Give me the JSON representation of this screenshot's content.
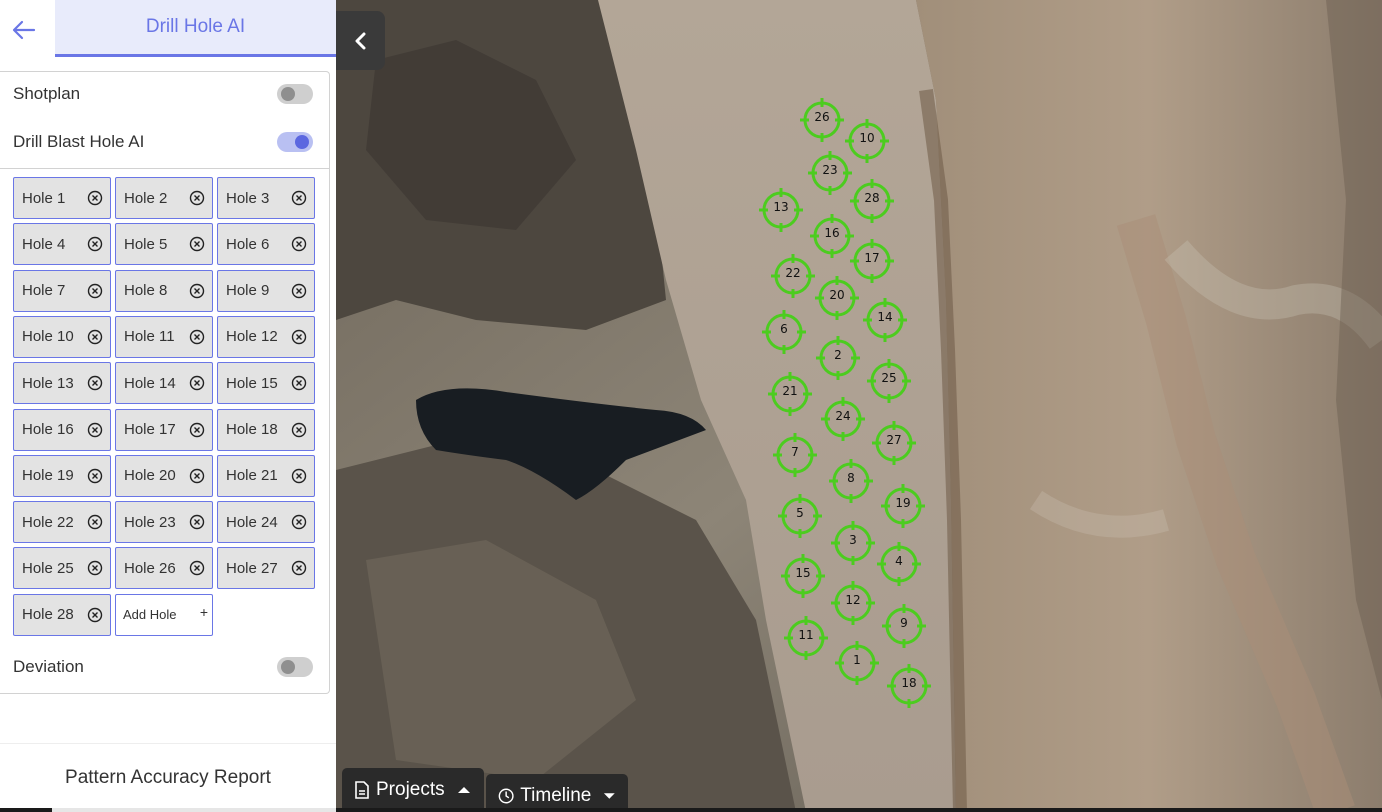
{
  "header": {
    "title": "Drill Hole AI",
    "back_icon": "arrow-left-icon",
    "accent": "#6a76e6"
  },
  "settings": {
    "shotplan": {
      "label": "Shotplan",
      "enabled": false
    },
    "drill_blast_hole_ai": {
      "label": "Drill Blast Hole AI",
      "enabled": true
    },
    "deviation": {
      "label": "Deviation",
      "enabled": false
    }
  },
  "holes": [
    "Hole 1",
    "Hole 2",
    "Hole 3",
    "Hole 4",
    "Hole 5",
    "Hole 6",
    "Hole 7",
    "Hole 8",
    "Hole 9",
    "Hole 10",
    "Hole 11",
    "Hole 12",
    "Hole 13",
    "Hole 14",
    "Hole 15",
    "Hole 16",
    "Hole 17",
    "Hole 18",
    "Hole 19",
    "Hole 20",
    "Hole 21",
    "Hole 22",
    "Hole 23",
    "Hole 24",
    "Hole 25",
    "Hole 26",
    "Hole 27",
    "Hole 28"
  ],
  "add_hole": {
    "label": "Add Hole",
    "icon": "+"
  },
  "footer": {
    "report_label": "Pattern Accuracy Report"
  },
  "map": {
    "collapse_icon": "chevron-left-icon",
    "marker_color": "#4ccc1f",
    "markers": [
      "26",
      "10",
      "23",
      "28",
      "13",
      "16",
      "17",
      "22",
      "20",
      "14",
      "6",
      "2",
      "25",
      "21",
      "24",
      "27",
      "7",
      "8",
      "19",
      "5",
      "3",
      "4",
      "15",
      "12",
      "9",
      "11",
      "1",
      "18"
    ]
  },
  "bottom_bar": {
    "projects": {
      "label": "Projects",
      "icon": "document-icon",
      "caret": "caret-up-icon"
    },
    "timeline": {
      "label": "Timeline",
      "icon": "clock-icon",
      "caret": "caret-down-icon"
    }
  }
}
